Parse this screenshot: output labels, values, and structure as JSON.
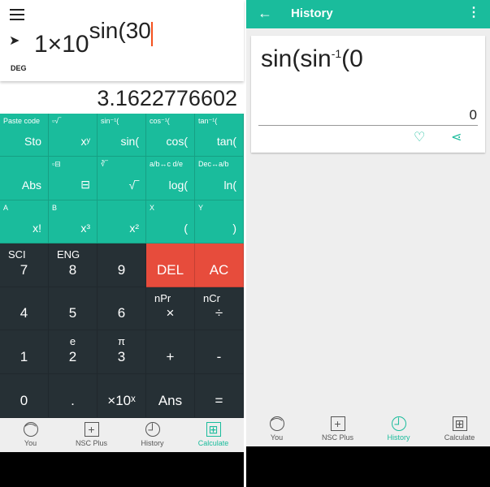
{
  "calculator": {
    "expression_base": "1×10",
    "expression_exponent": "sin(30",
    "mode": "DEG",
    "result": "3.1622776602",
    "teal_keys": [
      {
        "sub": "Paste code",
        "main": "Sto"
      },
      {
        "sub": "▫√‾",
        "main": "xʸ"
      },
      {
        "sub": "sin⁻¹(",
        "main": "sin("
      },
      {
        "sub": "cos⁻¹(",
        "main": "cos("
      },
      {
        "sub": "tan⁻¹(",
        "main": "tan("
      },
      {
        "sub": "",
        "main": "Abs"
      },
      {
        "sub": "▫⊟",
        "main": "⊟"
      },
      {
        "sub": "∛‾",
        "main": "√‾"
      },
      {
        "sub": "a/b↔c d/e",
        "main": "log("
      },
      {
        "sub": "Dec↔a/b",
        "main": "ln("
      },
      {
        "sub": "A",
        "main": "x!"
      },
      {
        "sub": "B",
        "main": "x³"
      },
      {
        "sub": "",
        "main": "x²"
      },
      {
        "sub": "X",
        "main": "("
      },
      {
        "sub": "Y",
        "main": ")"
      }
    ],
    "dark_keys": [
      {
        "sub": "SCI",
        "main": "7"
      },
      {
        "sub": "ENG",
        "main": "8"
      },
      {
        "sub": "",
        "main": "9"
      },
      {
        "sub": "",
        "main": "DEL",
        "red": true
      },
      {
        "sub": "",
        "main": "AC",
        "red": true
      },
      {
        "sub": "",
        "main": "4"
      },
      {
        "sub": "",
        "main": "5"
      },
      {
        "sub": "",
        "main": "6"
      },
      {
        "sub": "nPr",
        "main": "×"
      },
      {
        "sub": "nCr",
        "main": "÷"
      },
      {
        "sub": "",
        "main": "1"
      },
      {
        "sub": "e",
        "main": "2"
      },
      {
        "sub": "π",
        "main": "3"
      },
      {
        "sub": "",
        "main": "+"
      },
      {
        "sub": "",
        "main": "-"
      },
      {
        "sub": "",
        "main": "0"
      },
      {
        "sub": "",
        "main": "."
      },
      {
        "sub": "",
        "main": "×10ˣ"
      },
      {
        "sub": "",
        "main": "Ans"
      },
      {
        "sub": "",
        "main": "="
      }
    ]
  },
  "nav_left": [
    {
      "label": "You",
      "icon": "user-icon"
    },
    {
      "label": "NSC Plus",
      "icon": "plus-icon"
    },
    {
      "label": "History",
      "icon": "clock-icon"
    },
    {
      "label": "Calculate",
      "icon": "calculator-icon",
      "active": true
    }
  ],
  "history": {
    "title": "History",
    "expression": "sin(sin",
    "expression_sup": "-1",
    "expression_tail": "(0",
    "result": "0"
  },
  "nav_right": [
    {
      "label": "You",
      "icon": "user-icon"
    },
    {
      "label": "NSC Plus",
      "icon": "plus-icon"
    },
    {
      "label": "History",
      "icon": "clock-icon",
      "active": true
    },
    {
      "label": "Calculate",
      "icon": "calculator-icon"
    }
  ],
  "colors": {
    "accent": "#1abc9c",
    "dark_keys": "#263035",
    "delete": "#e74c3c",
    "cursor": "#f4511e"
  }
}
